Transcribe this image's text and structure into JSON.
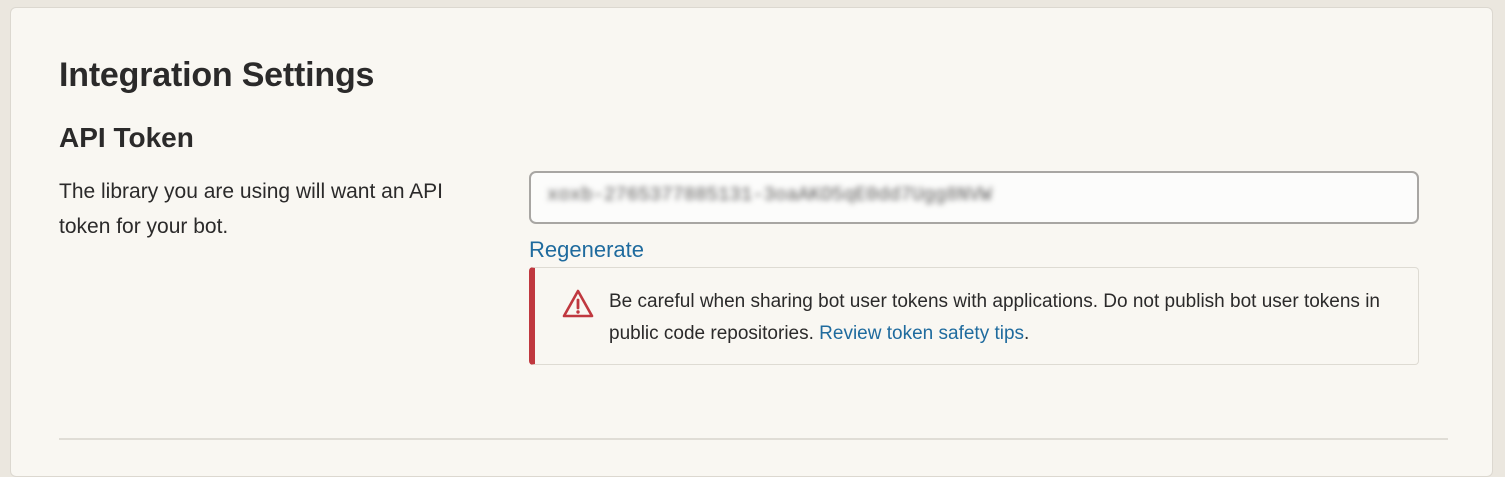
{
  "page": {
    "title": "Integration Settings"
  },
  "api_token": {
    "heading": "API Token",
    "description": "The library you are using will want an API token for your bot.",
    "token_value": "xoxb-2765377885131-3oaAKO5qE0dd7Ugg8NVW",
    "regenerate_label": "Regenerate",
    "warning": {
      "text": "Be careful when sharing bot user tokens with applications. Do not publish bot user tokens in public code repositories.",
      "link_label": "Review token safety tips",
      "trailing": "."
    }
  },
  "colors": {
    "link": "#1f6b9e",
    "warning_accent": "#c0383f",
    "panel_background": "#f9f7f2"
  },
  "icons": {
    "warning": "warning-triangle-icon"
  }
}
